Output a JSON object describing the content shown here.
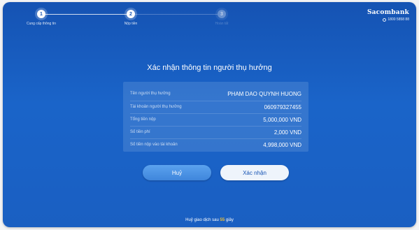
{
  "stepper": {
    "steps": [
      {
        "number": "1",
        "label": "Cung cấp thông tin",
        "state": "done"
      },
      {
        "number": "2",
        "label": "Nộp tiền",
        "state": "current"
      },
      {
        "number": "3",
        "label": "Hoàn tất",
        "state": "todo"
      }
    ]
  },
  "brand": {
    "name": "Sacombank",
    "hotline": "1800 5858 88"
  },
  "page": {
    "title": "Xác nhận thông tin người thụ hưởng"
  },
  "details": {
    "rows": [
      {
        "label": "Tên người thụ hưởng",
        "value": "PHAM DAO QUYNH HUONG"
      },
      {
        "label": "Tài khoản người thụ hưởng",
        "value": "060979327455"
      },
      {
        "label": "Tổng tiền nộp",
        "value": "5,000,000 VND"
      },
      {
        "label": "Số tiền phí",
        "value": "2,000 VND"
      },
      {
        "label": "Số tiền nộp vào tài khoản",
        "value": "4,998,000 VND"
      }
    ]
  },
  "actions": {
    "cancel_label": "Huỷ",
    "confirm_label": "Xác nhận"
  },
  "footer": {
    "prefix": "Huỷ giao dịch sau",
    "seconds": "55",
    "suffix": "giây"
  },
  "colors": {
    "background": "#1a5fc2",
    "accent": "#f5c02b",
    "cancel_button": "#4a90e2",
    "confirm_button": "#eef4fb"
  }
}
